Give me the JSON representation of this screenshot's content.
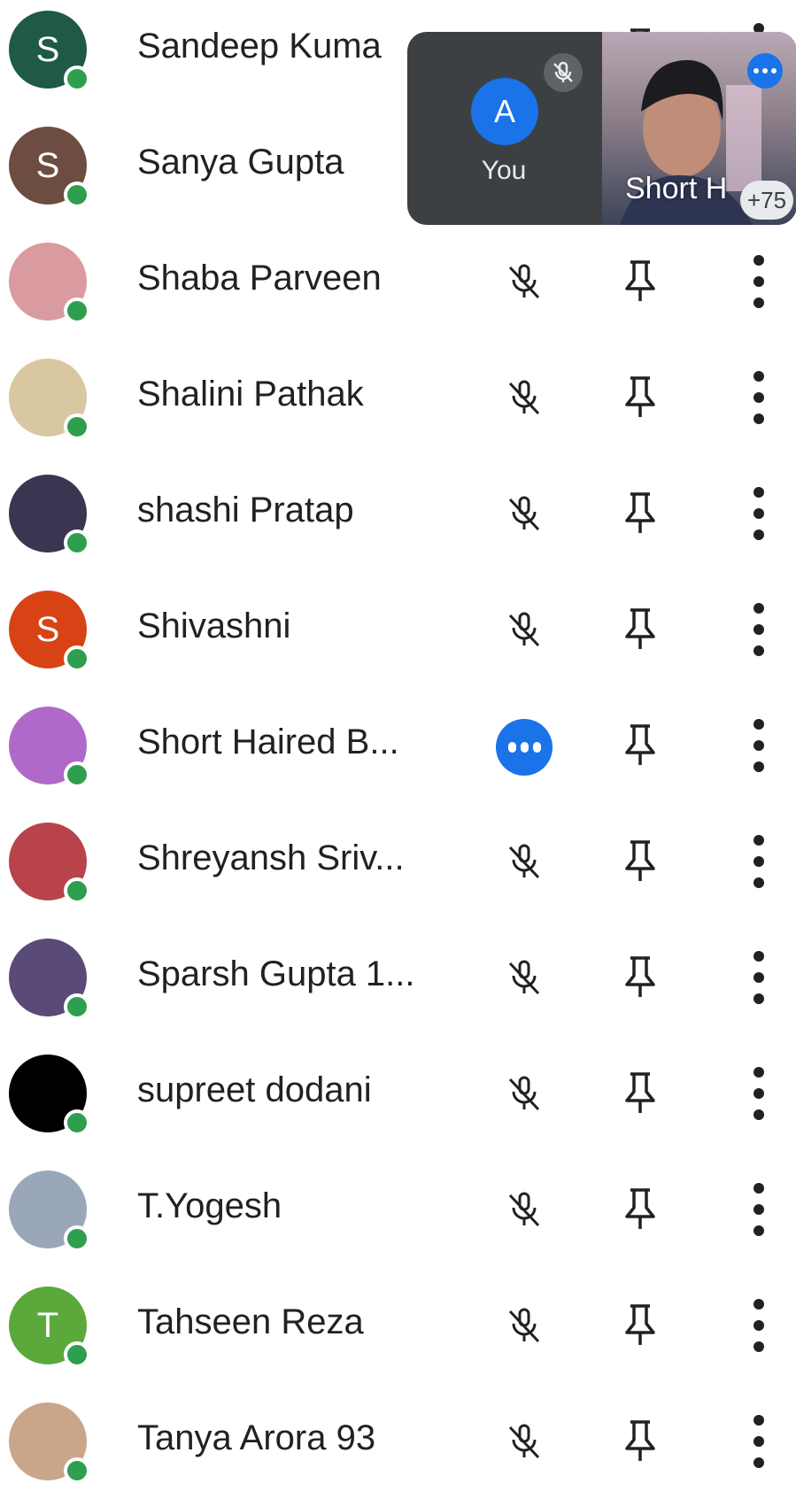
{
  "colors": {
    "online": "#2e9e4f",
    "speaking": "#1a73e8",
    "text": "#202124",
    "icon": "#202124",
    "overlay_bg": "#3c4043"
  },
  "participants": [
    {
      "name": "Sandeep Kuma",
      "avatar_letter": "S",
      "avatar_color": "#1e5a46",
      "avatar_type": "letter",
      "status": "muted"
    },
    {
      "name": "Sanya Gupta",
      "avatar_letter": "S",
      "avatar_color": "#6d4c41",
      "avatar_type": "letter",
      "status": "muted"
    },
    {
      "name": "Shaba Parveen",
      "avatar_letter": "",
      "avatar_color": "#d99aa0",
      "avatar_type": "photo",
      "status": "muted"
    },
    {
      "name": "Shalini Pathak",
      "avatar_letter": "",
      "avatar_color": "#d9c7a2",
      "avatar_type": "photo",
      "status": "muted"
    },
    {
      "name": "shashi Pratap",
      "avatar_letter": "",
      "avatar_color": "#3a3550",
      "avatar_type": "photo",
      "status": "muted"
    },
    {
      "name": "Shivashni",
      "avatar_letter": "S",
      "avatar_color": "#d84315",
      "avatar_type": "letter",
      "status": "muted"
    },
    {
      "name": "Short Haired B...",
      "avatar_letter": "",
      "avatar_color": "#b069c9",
      "avatar_type": "photo",
      "status": "speaking"
    },
    {
      "name": "Shreyansh Sriv...",
      "avatar_letter": "",
      "avatar_color": "#b8434a",
      "avatar_type": "photo",
      "status": "muted"
    },
    {
      "name": "Sparsh Gupta 1...",
      "avatar_letter": "",
      "avatar_color": "#5a4a78",
      "avatar_type": "photo",
      "status": "muted"
    },
    {
      "name": "supreet dodani",
      "avatar_letter": "",
      "avatar_color": "#000000",
      "avatar_type": "photo",
      "status": "muted"
    },
    {
      "name": "T.Yogesh",
      "avatar_letter": "",
      "avatar_color": "#9aa7b8",
      "avatar_type": "photo",
      "status": "muted"
    },
    {
      "name": "Tahseen Reza",
      "avatar_letter": "T",
      "avatar_color": "#5ba83b",
      "avatar_type": "letter",
      "status": "muted"
    },
    {
      "name": "Tanya Arora 93",
      "avatar_letter": "",
      "avatar_color": "#c9a58a",
      "avatar_type": "photo",
      "status": "muted"
    }
  ],
  "overlay": {
    "self_letter": "A",
    "self_label": "You",
    "video_label": "Short H",
    "more_count": "+75"
  }
}
